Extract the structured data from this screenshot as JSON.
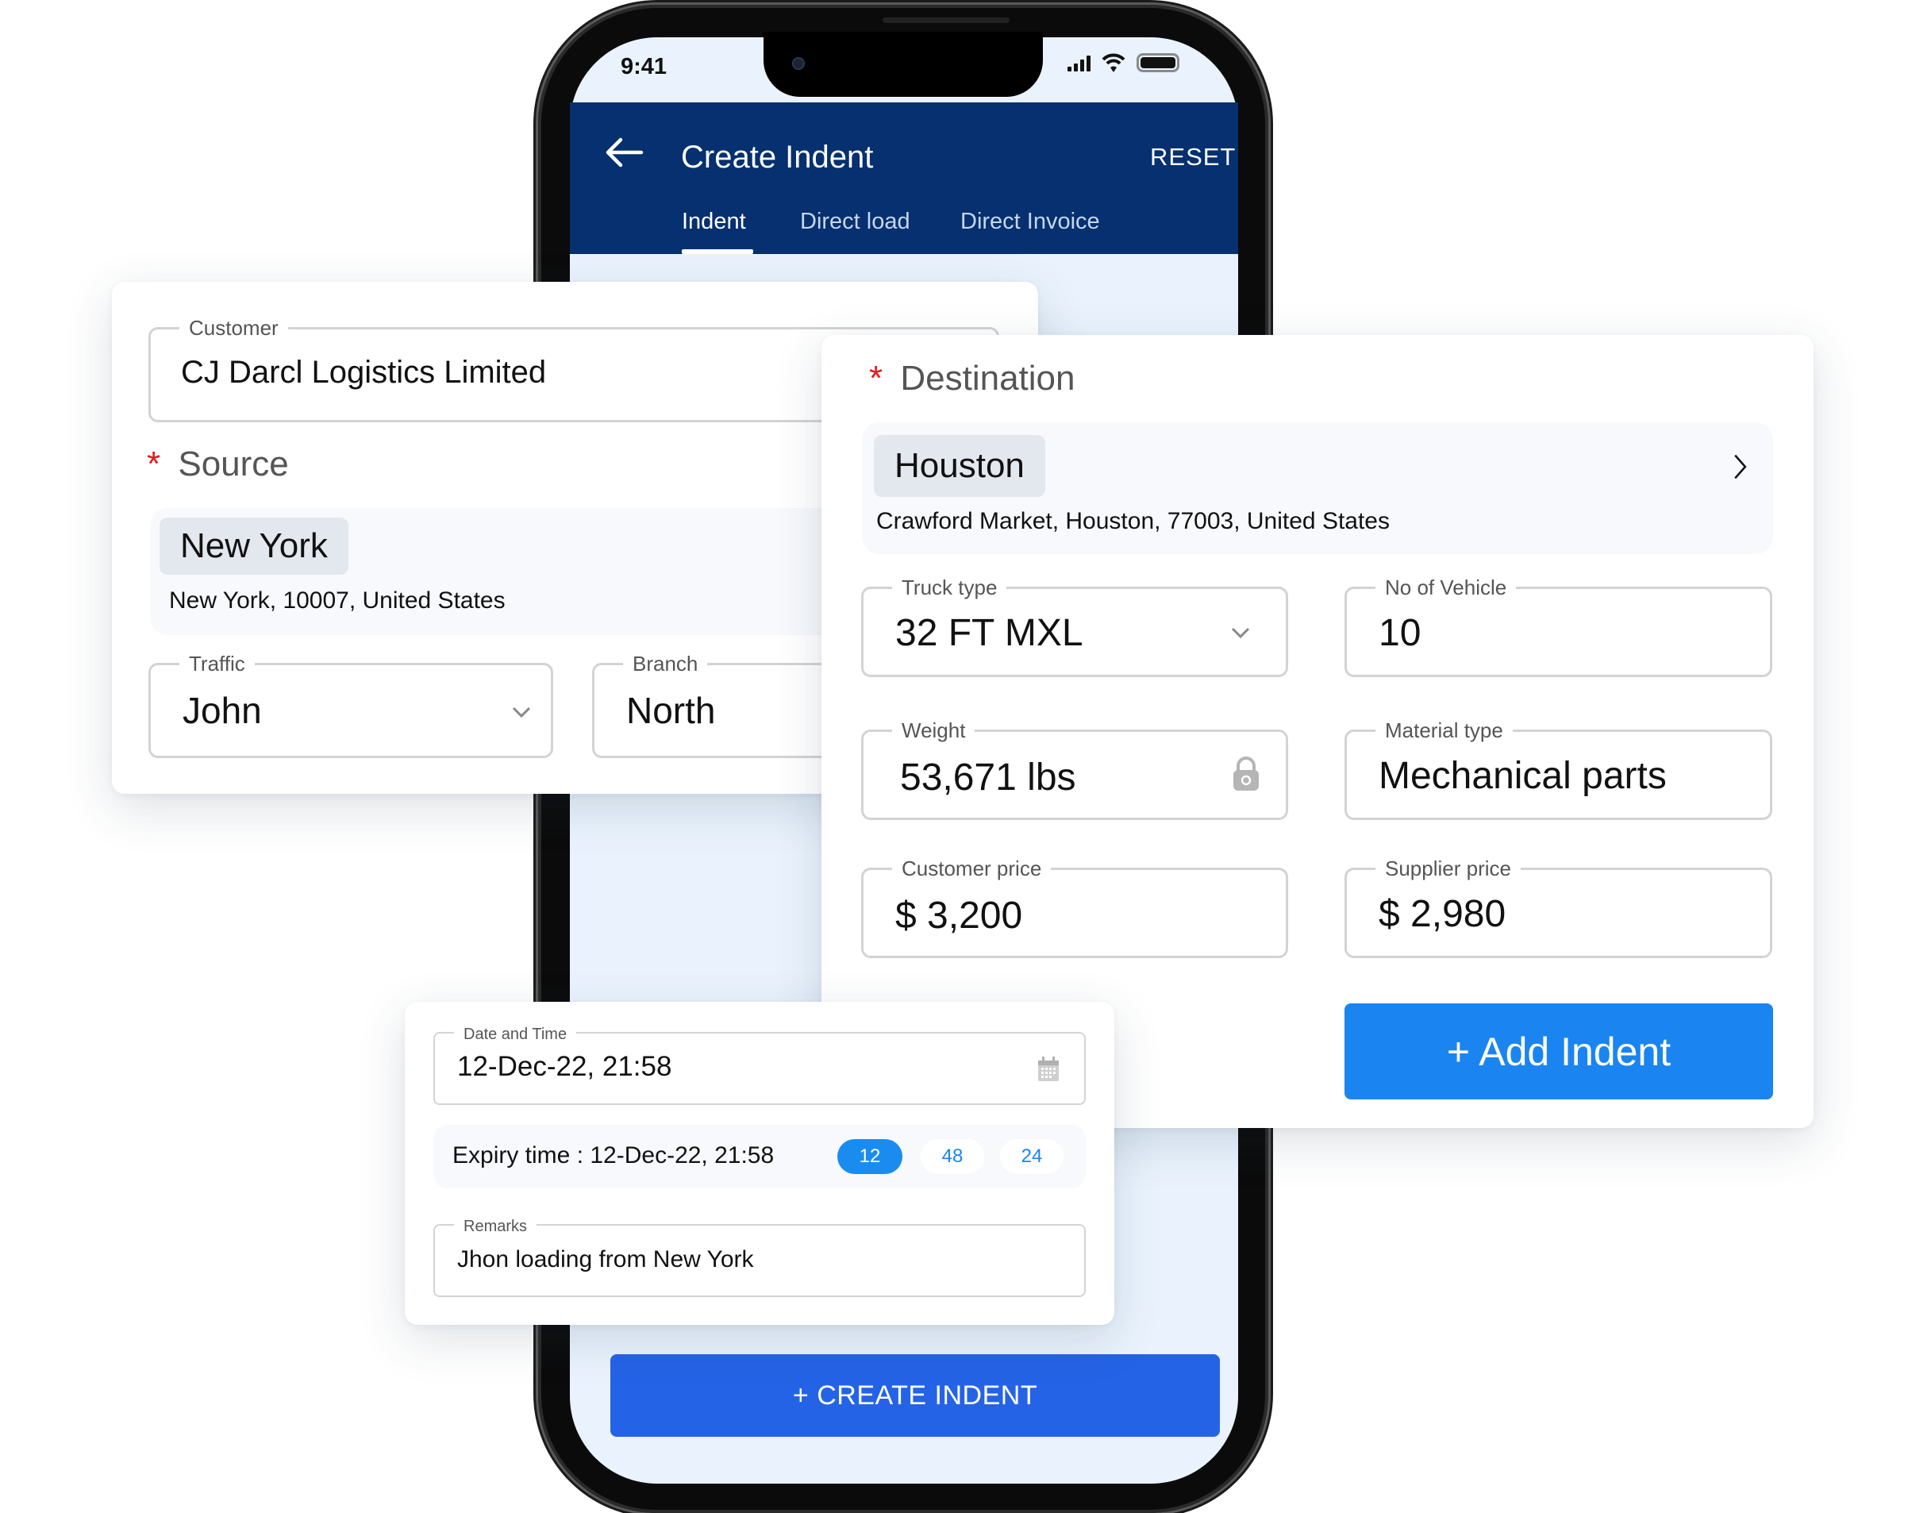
{
  "status_bar": {
    "time": "9:41"
  },
  "app_header": {
    "title": "Create Indent",
    "reset_label": "RESET",
    "back_icon": "arrow-left-icon",
    "tabs": [
      {
        "label": "Indent",
        "active": true
      },
      {
        "label": "Direct load",
        "active": false
      },
      {
        "label": "Direct Invoice",
        "active": false
      }
    ]
  },
  "source_card": {
    "customer": {
      "label": "Customer",
      "value": "CJ Darcl Logistics Limited"
    },
    "source": {
      "required_mark": "*",
      "label": "Source",
      "city": "New York",
      "address": "New York, 10007, United States"
    },
    "traffic": {
      "label": "Traffic",
      "value": "John",
      "icon": "chevron-down-icon"
    },
    "branch": {
      "label": "Branch",
      "value": "North"
    }
  },
  "destination_card": {
    "destination": {
      "required_mark": "*",
      "label": "Destination",
      "city": "Houston",
      "address": "Crawford Market, Houston, 77003, United States",
      "icon": "chevron-right-icon"
    },
    "truck_type": {
      "label": "Truck type",
      "value": "32 FT MXL",
      "icon": "chevron-down-icon"
    },
    "no_of_vehicle": {
      "label": "No of Vehicle",
      "value": "10"
    },
    "weight": {
      "label": "Weight",
      "value": "53,671 lbs",
      "icon": "lock-icon"
    },
    "material_type": {
      "label": "Material type",
      "value": "Mechanical parts"
    },
    "customer_price": {
      "label": "Customer price",
      "value": "$ 3,200"
    },
    "supplier_price": {
      "label": "Supplier price",
      "value": "$ 2,980"
    },
    "add_button": "+ Add Indent"
  },
  "time_card": {
    "date_time": {
      "label": "Date and Time",
      "value": "12-Dec-22, 21:58",
      "icon": "calendar-icon"
    },
    "expiry": {
      "text": "Expiry time : 12-Dec-22, 21:58",
      "options": [
        {
          "label": "12",
          "active": true
        },
        {
          "label": "48",
          "active": false
        },
        {
          "label": "24",
          "active": false
        }
      ]
    },
    "remarks": {
      "label": "Remarks",
      "value": "Jhon loading from New York"
    }
  },
  "footer": {
    "create_button": "+ CREATE INDENT"
  },
  "colors": {
    "header_navy": "#06306f",
    "primary_blue": "#1a85f0",
    "create_blue": "#2563e6",
    "required_red": "#e11d1d"
  }
}
